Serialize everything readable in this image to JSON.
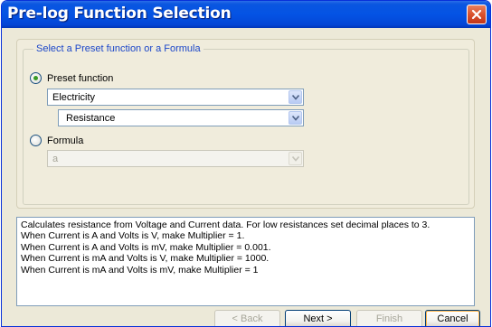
{
  "window": {
    "title": "Pre-log Function Selection"
  },
  "group": {
    "legend": "Select a Preset function or a Formula"
  },
  "preset": {
    "radio_label": "Preset function",
    "checked": true,
    "category_value": "Electricity",
    "function_value": "Resistance"
  },
  "formula": {
    "radio_label": "Formula",
    "checked": false,
    "value": "a"
  },
  "description": {
    "lines": [
      "Calculates resistance from Voltage and Current data. For low resistances set decimal places to 3.",
      "When Current is A and Volts is V, make Multiplier = 1.",
      "When Current is A and Volts is mV, make Multiplier = 0.001.",
      "When Current is mA and Volts is V, make Multiplier = 1000.",
      "When Current is mA and Volts is mV, make Multiplier = 1"
    ]
  },
  "buttons": {
    "back": "< Back",
    "next": "Next >",
    "finish": "Finish",
    "cancel": "Cancel"
  },
  "icons": {
    "close": "close-icon",
    "dropdown": "chevron-down-icon"
  },
  "colors": {
    "titlebar": "#0453e4",
    "legend_text": "#1c47c9",
    "radio_dot": "#3a9a24",
    "close_button": "#d9522c"
  }
}
